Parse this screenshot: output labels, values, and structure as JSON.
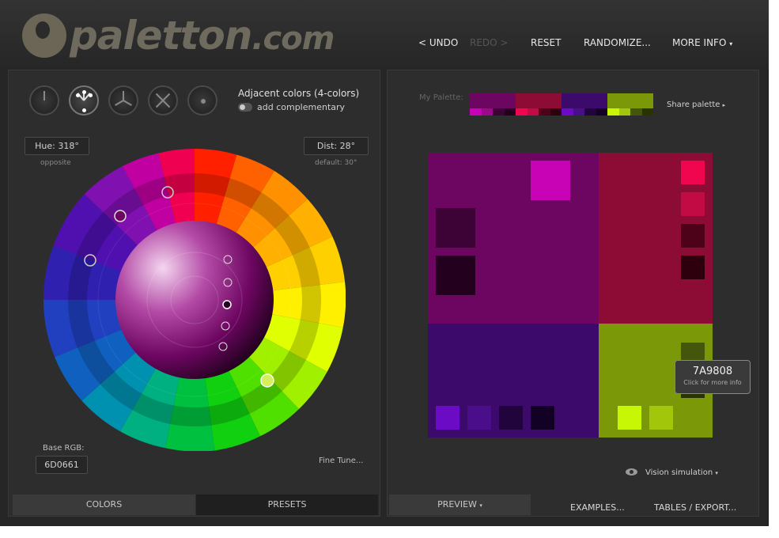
{
  "header": {
    "logo_main": "paletton",
    "logo_suffix": ".com",
    "nav": {
      "undo": "< UNDO",
      "redo": "REDO >",
      "reset": "RESET",
      "randomize": "RANDOMIZE...",
      "more_info": "MORE INFO",
      "more_info_arrow": "▾"
    }
  },
  "scheme": {
    "title": "Adjacent colors (4-colors)",
    "toggle_label": "add complementary",
    "types": [
      "mono",
      "adjacent",
      "triad",
      "tetrad",
      "free"
    ]
  },
  "controls": {
    "hue_label": "Hue: 318°",
    "hue_sub": "opposite",
    "dist_label": "Dist: 28°",
    "dist_sub": "default: 30°",
    "base_rgb_label": "Base RGB:",
    "base_rgb_value": "6D0661",
    "fine_tune": "Fine Tune..."
  },
  "left_tabs": {
    "colors": "COLORS",
    "presets": "PRESETS"
  },
  "palette": {
    "label": "My Palette:",
    "share": "Share palette",
    "share_arrow": "▸",
    "blocks": [
      {
        "main": "#6D0661",
        "shades": [
          "#C802B5",
          "#9A0A8B",
          "#3D0236",
          "#24001F"
        ]
      },
      {
        "main": "#8C0C35",
        "shades": [
          "#F0054F",
          "#C20A45",
          "#4E0219",
          "#2E000E"
        ]
      },
      {
        "main": "#3C0A6B",
        "shades": [
          "#6B0BC6",
          "#4A0E8A",
          "#21043C",
          "#120124"
        ]
      },
      {
        "main": "#7A9808",
        "shades": [
          "#C8F705",
          "#A2C60A",
          "#44560C",
          "#283300"
        ]
      }
    ]
  },
  "preview": {
    "quads": [
      {
        "name": "primary",
        "color": "#6D0661"
      },
      {
        "name": "secondary-1",
        "color": "#8C0C35"
      },
      {
        "name": "secondary-2",
        "color": "#3C0A6B"
      },
      {
        "name": "complement",
        "color": "#7A9808"
      }
    ],
    "tooltip_hex": "7A9808",
    "tooltip_hint": "Click for more info"
  },
  "vision": {
    "label": "Vision simulation",
    "arrow": "▾"
  },
  "right_tabs": {
    "preview": "PREVIEW",
    "preview_arrow": "▾",
    "examples": "EXAMPLES...",
    "tables": "TABLES / EXPORT..."
  }
}
